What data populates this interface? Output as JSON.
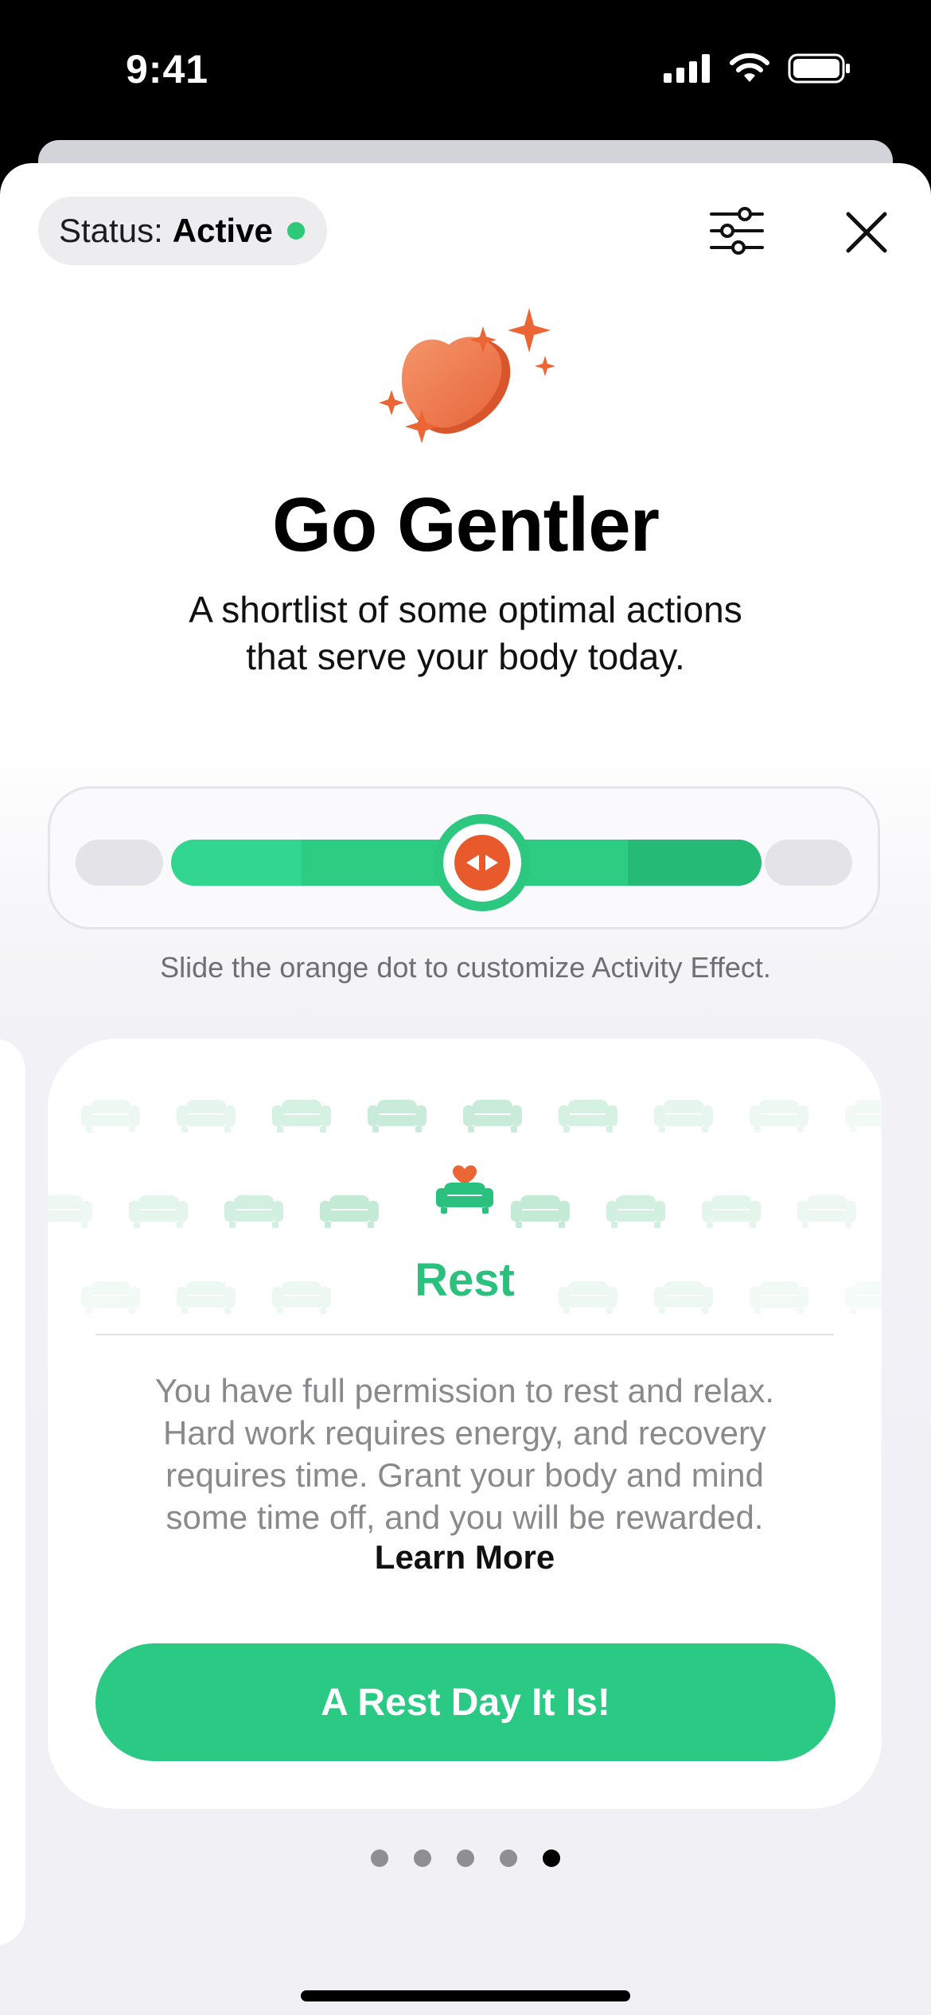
{
  "status_bar": {
    "time": "9:41",
    "icons": [
      "cellular-signal-icon",
      "wifi-icon",
      "battery-icon"
    ]
  },
  "header": {
    "status_label": "Status:",
    "status_value": "Active",
    "status_color": "#2dc878",
    "filter_icon": "sliders-icon",
    "close_icon": "close-icon"
  },
  "hero": {
    "icon": "heart-sparkles-icon",
    "title": "Go Gentler",
    "subtitle_line1": "A shortlist of some optimal actions",
    "subtitle_line2": "that serve your body today."
  },
  "slider": {
    "hint": "Slide the orange dot to customize Activity Effect.",
    "knob_icon": "left-right-arrows-icon"
  },
  "card": {
    "icon": "couch-heart-icon",
    "title": "Rest",
    "description_lines": [
      "You have full permission to rest and relax.",
      "Hard work requires energy, and recovery",
      "requires time. Grant your body and mind",
      "some time off, and you will be rewarded."
    ],
    "learn_more": "Learn More",
    "cta": "A Rest Day It Is!"
  },
  "pagination": {
    "pages": 5,
    "active_index": 4
  },
  "colors": {
    "accent_green": "#2ac984",
    "accent_orange": "#e8592c",
    "text_secondary": "#8a8a8e"
  }
}
